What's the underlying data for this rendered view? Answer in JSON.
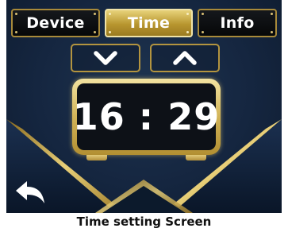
{
  "tabs": [
    {
      "label": "Device",
      "active": false
    },
    {
      "label": "Time",
      "active": true
    },
    {
      "label": "Info",
      "active": false
    }
  ],
  "controls": {
    "decrease_icon": "chevron-down-icon",
    "increase_icon": "chevron-up-icon",
    "back_icon": "back-arrow-icon"
  },
  "clock": {
    "hours": "16",
    "separator": " : ",
    "minutes": "29"
  },
  "caption": "Time setting Screen",
  "colors": {
    "gold": "#d2b458",
    "background": "#152640",
    "tab_dark": "#0b0d10"
  }
}
